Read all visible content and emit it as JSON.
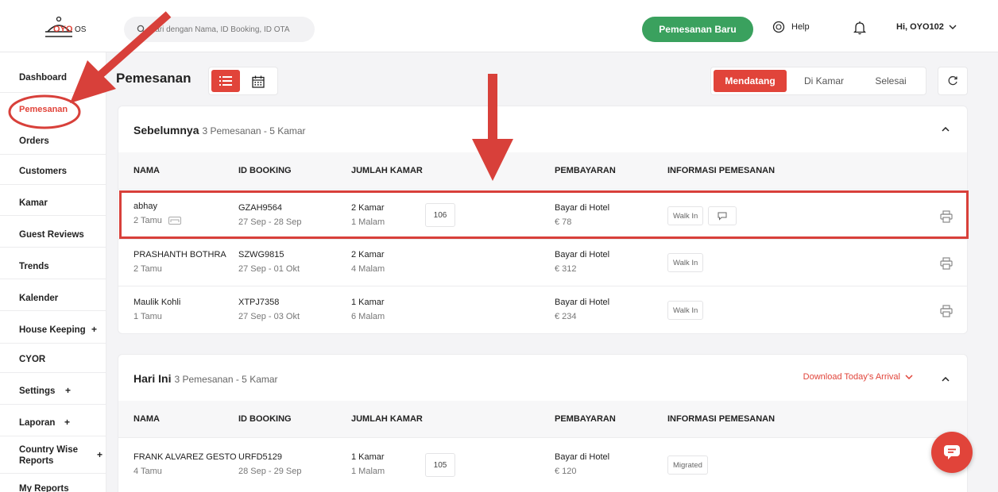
{
  "header": {
    "logo_text": "OYO",
    "logo_suffix": "OS",
    "search_placeholder": "Cari dengan Nama, ID Booking, ID OTA",
    "new_booking_label": "Pemesanan Baru",
    "help_label": "Help",
    "user_greeting": "Hi, OYO102"
  },
  "sidebar": {
    "items": [
      {
        "label": "Dashboard"
      },
      {
        "label": "Pemesanan",
        "active": true
      },
      {
        "label": "Orders"
      },
      {
        "label": "Customers"
      },
      {
        "label": "Kamar"
      },
      {
        "label": "Guest Reviews"
      },
      {
        "label": "Trends"
      },
      {
        "label": "Kalender"
      },
      {
        "label": "House Keeping",
        "expandable": true
      },
      {
        "label": "CYOR"
      },
      {
        "label": "Settings",
        "expandable": true
      },
      {
        "label": "Laporan",
        "expandable": true
      },
      {
        "label": "Country Wise Reports",
        "expandable": true
      },
      {
        "label": "My Reports"
      }
    ],
    "plus": "+"
  },
  "page": {
    "title": "Pemesanan",
    "tabs": [
      "Mendatang",
      "Di Kamar",
      "Selesai"
    ],
    "active_tab": "Mendatang"
  },
  "columns": {
    "name": "NAMA",
    "booking_id": "ID BOOKING",
    "rooms": "JUMLAH KAMAR",
    "payment": "PEMBAYARAN",
    "info": "INFORMASI PEMESANAN"
  },
  "sections": [
    {
      "title": "Sebelumnya",
      "summary": "3 Pemesanan - 5 Kamar",
      "rows": [
        {
          "name": "abhay",
          "guests": "2 Tamu",
          "booking_id": "GZAH9564",
          "dates": "27 Sep - 28 Sep",
          "rooms": "2 Kamar",
          "nights": "1 Malam",
          "room_no": "106",
          "payment": "Bayar di Hotel",
          "amount": "€ 78",
          "tag": "Walk In"
        },
        {
          "name": "PRASHANTH BOTHRA",
          "guests": "2 Tamu",
          "booking_id": "SZWG9815",
          "dates": "27 Sep - 01 Okt",
          "rooms": "2 Kamar",
          "nights": "4 Malam",
          "room_no": "",
          "payment": "Bayar di Hotel",
          "amount": "€ 312",
          "tag": "Walk In"
        },
        {
          "name": "Maulik Kohli",
          "guests": "1 Tamu",
          "booking_id": "XTPJ7358",
          "dates": "27 Sep - 03 Okt",
          "rooms": "1 Kamar",
          "nights": "6 Malam",
          "room_no": "",
          "payment": "Bayar di Hotel",
          "amount": "€ 234",
          "tag": "Walk In"
        }
      ]
    },
    {
      "title": "Hari Ini",
      "summary": "3 Pemesanan - 5 Kamar",
      "download_label": "Download Today's Arrival",
      "rows": [
        {
          "name": "FRANK ALVAREZ GESTO",
          "guests": "4 Tamu",
          "booking_id": "URFD5129",
          "dates": "28 Sep - 29 Sep",
          "rooms": "1 Kamar",
          "nights": "1 Malam",
          "room_no": "105",
          "payment": "Bayar di Hotel",
          "amount": "€ 120",
          "tag": "Migrated"
        }
      ]
    }
  ],
  "colors": {
    "accent": "#e1443a",
    "green": "#3aa15e"
  },
  "icons": [
    "search-icon",
    "help-icon",
    "bell-icon",
    "chevron-down-icon",
    "list-icon",
    "calendar-icon",
    "refresh-icon",
    "chevron-up-icon",
    "bed-icon",
    "message-icon",
    "printer-icon",
    "chat-icon",
    "arrow-annotation"
  ]
}
